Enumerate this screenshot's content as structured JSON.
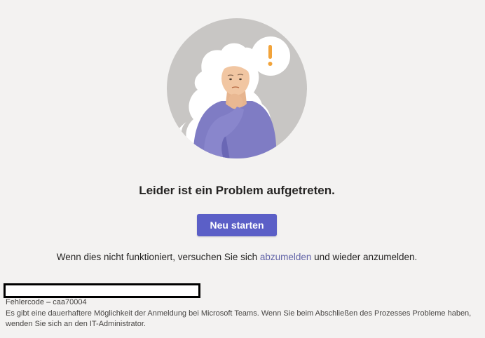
{
  "illustration": {
    "icon": "confused-person-thinking-icon",
    "bubble_symbol": "!"
  },
  "colors": {
    "background": "#f3f2f1",
    "primary_button": "#5b5fc7",
    "link": "#6264a7",
    "exclamation": "#f2a33a"
  },
  "main": {
    "title": "Leider ist ein Problem aufgetreten.",
    "restart_label": "Neu starten",
    "hint_before": "Wenn dies nicht funktioniert, versuchen Sie sich ",
    "hint_link": "abzumelden",
    "hint_after": " und wieder anzumelden."
  },
  "footer": {
    "error_code": "Fehlercode – caa70004",
    "description": "Es gibt eine dauerhaftere Möglichkeit der Anmeldung bei Microsoft Teams. Wenn Sie beim Abschließen des Prozesses Probleme haben, wenden Sie sich an den IT-Administrator."
  }
}
